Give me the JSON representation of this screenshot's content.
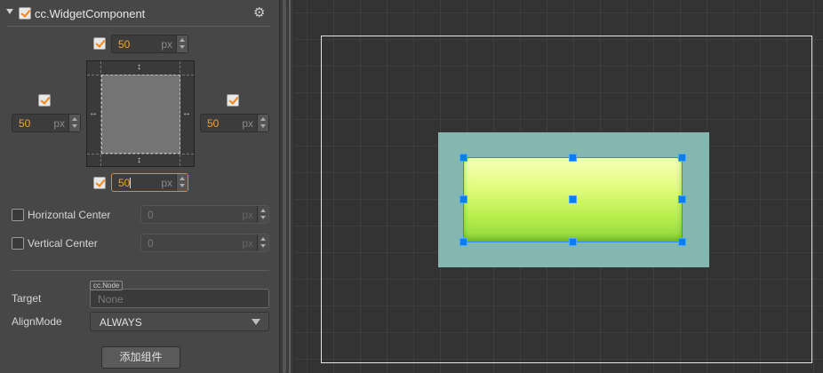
{
  "component": {
    "title": "cc.WidgetComponent",
    "enabled": true
  },
  "widget": {
    "top": {
      "checked": true,
      "value": "50",
      "unit": "px"
    },
    "left": {
      "checked": true,
      "value": "50",
      "unit": "px"
    },
    "right": {
      "checked": true,
      "value": "50",
      "unit": "px"
    },
    "bottom": {
      "checked": true,
      "value": "50",
      "unit": "px"
    },
    "horizontal_center": {
      "label": "Horizontal Center",
      "checked": false,
      "value": "0",
      "unit": "px"
    },
    "vertical_center": {
      "label": "Vertical Center",
      "checked": false,
      "value": "0",
      "unit": "px"
    },
    "target": {
      "label": "Target",
      "type_tag": "cc.Node",
      "placeholder": "None"
    },
    "align_mode": {
      "label": "AlignMode",
      "value": "ALWAYS"
    }
  },
  "add_component_label": "添加组件",
  "icons": {
    "gear": "⚙",
    "arrow_v": "↕",
    "arrow_h": "↔"
  },
  "colors": {
    "accent": "#f2851a",
    "selection": "#0a7df0",
    "parent_node": "#84b7b0",
    "button_green": "#b9ee4d"
  }
}
